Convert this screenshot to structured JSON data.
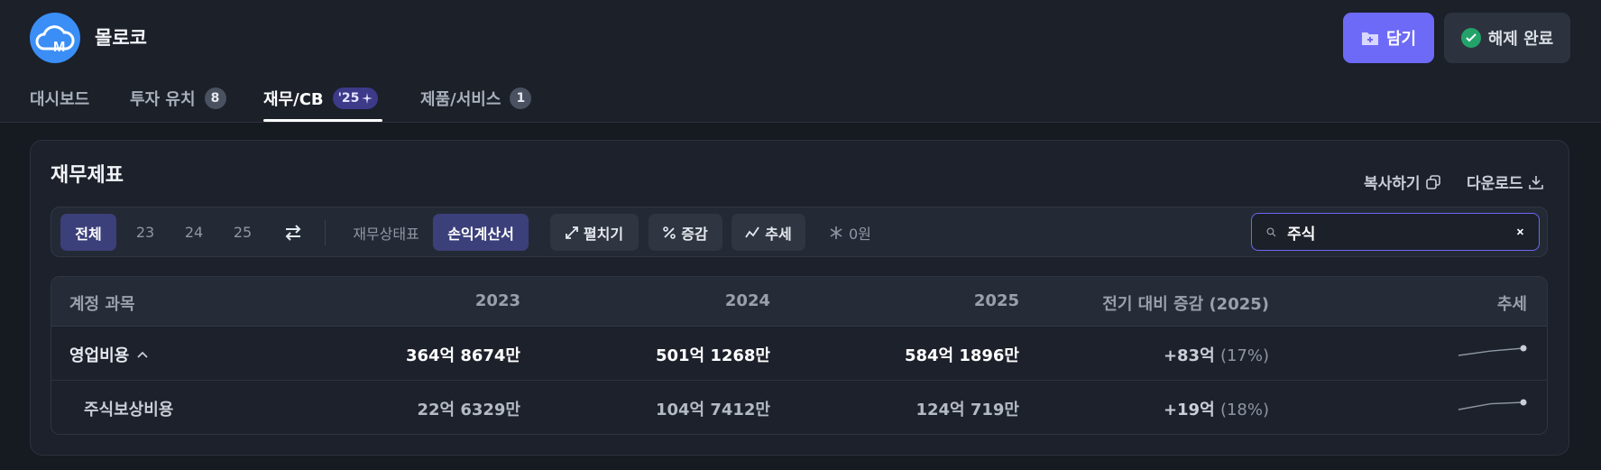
{
  "company": {
    "name": "몰로코"
  },
  "actions": {
    "save_label": "담기",
    "done_label": "해제 완료"
  },
  "tabs": [
    {
      "label": "대시보드",
      "badge": ""
    },
    {
      "label": "투자 유치",
      "badge": "8"
    },
    {
      "label": "재무/CB",
      "badge": "'25"
    },
    {
      "label": "제품/서비스",
      "badge": "1"
    }
  ],
  "panel": {
    "title": "재무제표",
    "copy_label": "복사하기",
    "download_label": "다운로드"
  },
  "toolbar": {
    "years": [
      "전체",
      "23",
      "24",
      "25"
    ],
    "statements": [
      "재무상태표",
      "손익계산서"
    ],
    "expand_label": "펼치기",
    "change_label": "증감",
    "trend_label": "추세",
    "zero_label": "0원",
    "search_value": "주식"
  },
  "table": {
    "headers": [
      "계정 과목",
      "2023",
      "2024",
      "2025",
      "전기 대비 증감 (2025)",
      "추세"
    ],
    "rows": [
      {
        "account": "영업비용",
        "y2023": "364억 8674만",
        "y2024": "501억 1268만",
        "y2025": "584억 1896만",
        "change": "+83억",
        "change_pct": "(17%)",
        "trend": [
          364.87,
          501.13,
          584.19
        ]
      },
      {
        "account": "주식보상비용",
        "y2023": "22억 6329만",
        "y2024": "104억 7412만",
        "y2025": "124억 719만",
        "change": "+19억",
        "change_pct": "(18%)",
        "trend": [
          22.63,
          104.74,
          124.07
        ]
      }
    ]
  },
  "colors": {
    "accent": "#6d6af7",
    "success": "#23a36a",
    "logo": "#3a8ef6"
  }
}
